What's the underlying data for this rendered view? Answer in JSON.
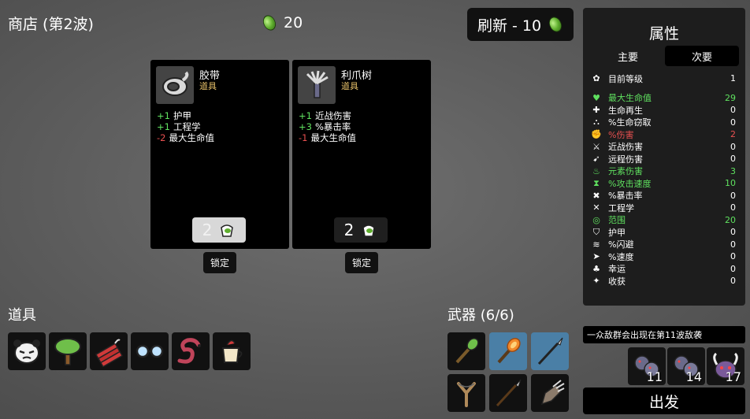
{
  "header": {
    "shop_title": "商店 (第2波)",
    "materials": "20",
    "reroll_label": "刷新 - 10"
  },
  "shop_cards": [
    {
      "name": "胶带",
      "type": "道具",
      "icon": "tape-icon",
      "stats": [
        {
          "value": "+1",
          "label": "护甲"
        },
        {
          "value": "+1",
          "label": "工程学"
        },
        {
          "value": "-2",
          "label": "最大生命值"
        }
      ],
      "price": "2",
      "lock_label": "锁定"
    },
    {
      "name": "利爪树",
      "type": "道具",
      "icon": "claw-tree-icon",
      "stats": [
        {
          "value": "+1",
          "label": "近战伤害"
        },
        {
          "value": "+3",
          "label": "%暴击率"
        },
        {
          "value": "-1",
          "label": "最大生命值"
        }
      ],
      "price": "2",
      "lock_label": "锁定"
    }
  ],
  "items_section": {
    "title": "道具",
    "items": [
      "panda-face-icon",
      "tree-icon",
      "dynamite-icon",
      "glasses-icon",
      "snake-icon",
      "coffee-cup-icon"
    ]
  },
  "weapons_section": {
    "title": "武器 (6/6)",
    "weapons": [
      "spiked-club-icon",
      "torch-icon",
      "spear-icon",
      "slingshot-icon",
      "spear-icon",
      "claw-gauntlet-icon"
    ]
  },
  "stats_panel": {
    "title": "属性",
    "tabs": [
      "主要",
      "次要"
    ],
    "active_tab": "次要",
    "level": {
      "label": "目前等级",
      "value": "1"
    },
    "rows": [
      {
        "label": "最大生命值",
        "value": "29",
        "color": "#5fe05f",
        "icon": "heart-icon"
      },
      {
        "label": "生命再生",
        "value": "0",
        "color": "#ffffff",
        "icon": "regen-icon"
      },
      {
        "label": "%生命窃取",
        "value": "0",
        "color": "#ffffff",
        "icon": "lifesteal-icon"
      },
      {
        "label": "%伤害",
        "value": "2",
        "color": "#e85050",
        "icon": "damage-icon"
      },
      {
        "label": "近战伤害",
        "value": "0",
        "color": "#ffffff",
        "icon": "melee-icon"
      },
      {
        "label": "远程伤害",
        "value": "0",
        "color": "#ffffff",
        "icon": "ranged-icon"
      },
      {
        "label": "元素伤害",
        "value": "3",
        "color": "#5fe05f",
        "icon": "elemental-icon"
      },
      {
        "label": "%攻击速度",
        "value": "10",
        "color": "#5fe05f",
        "icon": "attack-speed-icon"
      },
      {
        "label": "%暴击率",
        "value": "0",
        "color": "#ffffff",
        "icon": "crit-icon"
      },
      {
        "label": "工程学",
        "value": "0",
        "color": "#ffffff",
        "icon": "engineering-icon"
      },
      {
        "label": "范围",
        "value": "20",
        "color": "#5fe05f",
        "icon": "range-icon"
      },
      {
        "label": "护甲",
        "value": "0",
        "color": "#ffffff",
        "icon": "armor-icon"
      },
      {
        "label": "%闪避",
        "value": "0",
        "color": "#ffffff",
        "icon": "dodge-icon"
      },
      {
        "label": "%速度",
        "value": "0",
        "color": "#ffffff",
        "icon": "speed-icon"
      },
      {
        "label": "幸运",
        "value": "0",
        "color": "#ffffff",
        "icon": "luck-icon"
      },
      {
        "label": "收获",
        "value": "0",
        "color": "#ffffff",
        "icon": "harvest-icon"
      }
    ]
  },
  "wave_info": {
    "text": "一众敌群会出现在第11波敌袭",
    "enemies": [
      {
        "count": "11",
        "icon": "enemy-group-icon"
      },
      {
        "count": "14",
        "icon": "enemy-group-icon"
      },
      {
        "count": "17",
        "icon": "horned-boss-icon"
      }
    ]
  },
  "go_label": "出发"
}
